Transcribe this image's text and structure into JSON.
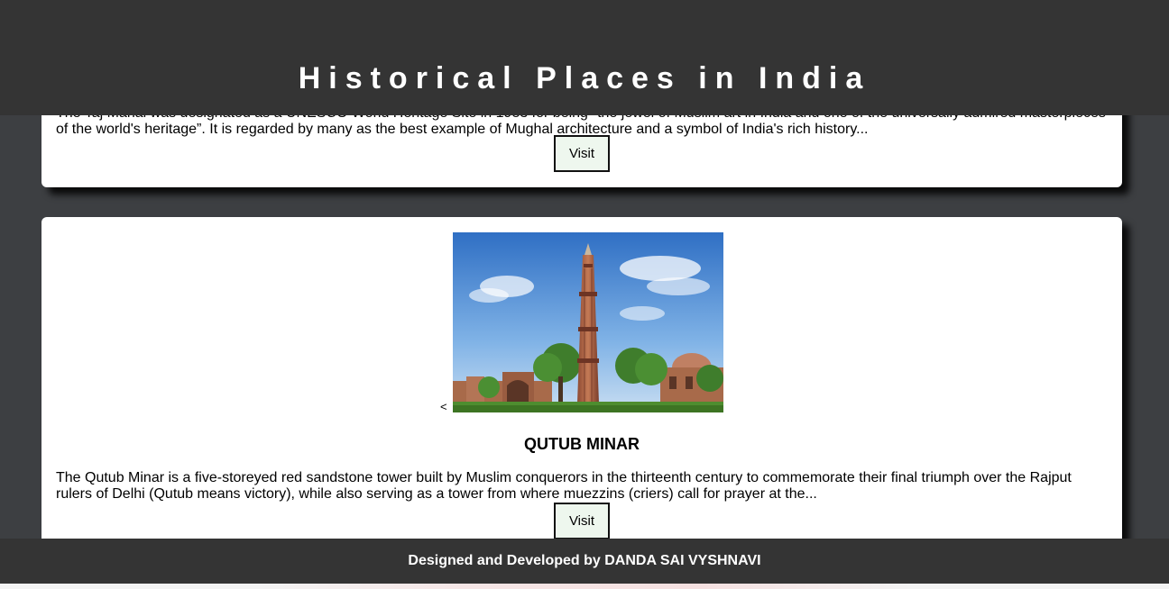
{
  "header": {
    "title": "Historical Places in India"
  },
  "cards": [
    {
      "description_visible_top": "The Taj Mahal was designated as a UNESCO World Heritage Site in 1983 for being \"the jewel of Muslim art in India and one of the universally admired masterpieces",
      "description_visible_bottom": "of the world's heritage”. It is regarded by many as the best example of Mughal architecture and a symbol of India's rich history...",
      "visit_label": "Visit"
    },
    {
      "prev_label": "<",
      "image_alt": "Qutub Minar",
      "title": "QUTUB MINAR",
      "description": "The Qutub Minar is a five-storeyed red sandstone tower built by Muslim conquerors in the thirteenth century to commemorate their final triumph over the Rajput rulers of Delhi (Qutub means victory), while also serving as a tower from where muezzins (criers) call for prayer at the...",
      "visit_label": "Visit"
    }
  ],
  "footer": {
    "credit": "Designed and Developed by DANDA SAI VYSHNAVI"
  }
}
